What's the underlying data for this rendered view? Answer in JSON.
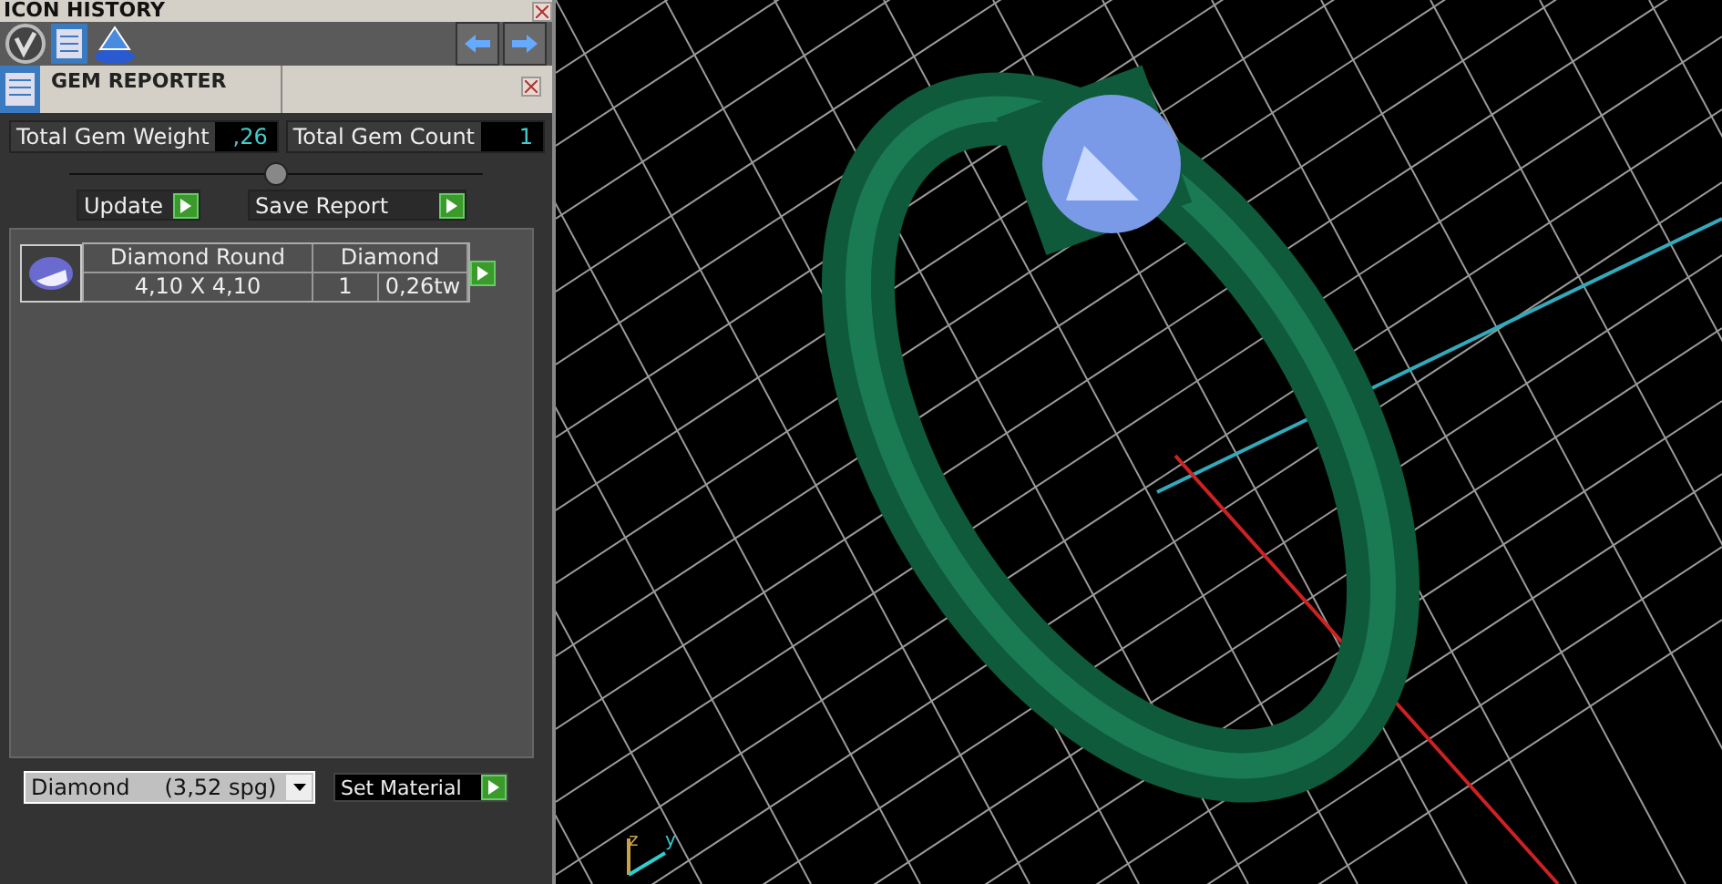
{
  "icon_history": {
    "title": "ICON HISTORY"
  },
  "gem_reporter": {
    "title": "GEM REPORTER"
  },
  "totals": [
    {
      "label": "Total Gem Weight",
      "value": ",26"
    },
    {
      "label": "Total Gem Count",
      "value": "1"
    }
  ],
  "actions": [
    "Update",
    "Save Report"
  ],
  "gems": [
    {
      "name": "Diamond Round",
      "material": "Diamond",
      "size": "4,10 X 4,10",
      "count": "1",
      "weight": "0,26tw"
    }
  ],
  "material_select": {
    "value": "Diamond     (3,52 spg)"
  },
  "set_material": "Set Material",
  "axis_labels": [
    "z",
    "y"
  ]
}
